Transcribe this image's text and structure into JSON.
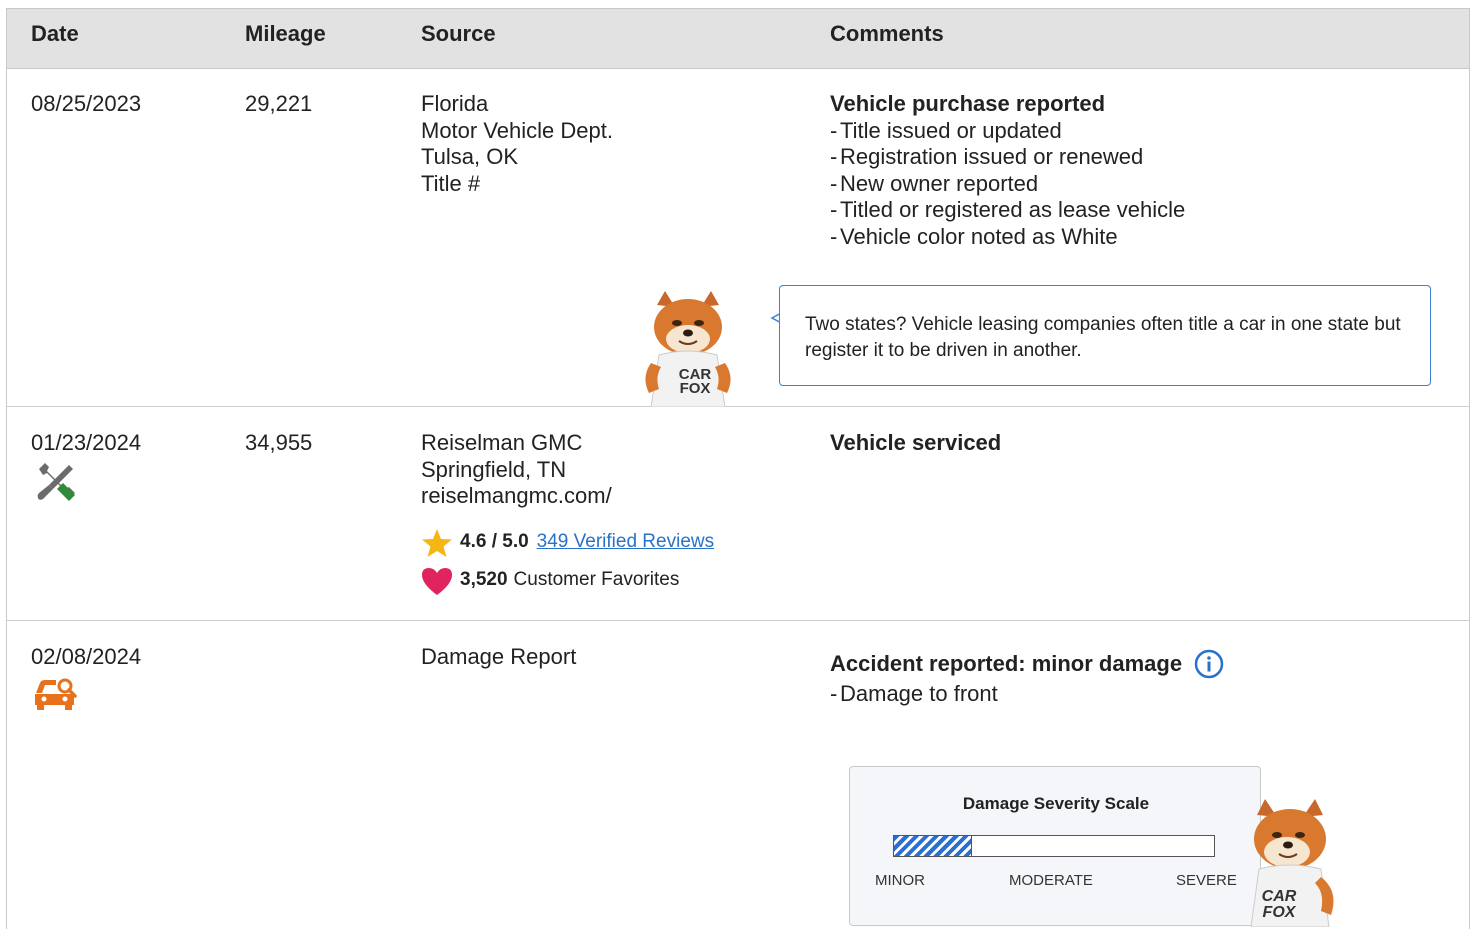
{
  "header": {
    "date": "Date",
    "mileage": "Mileage",
    "source": "Source",
    "comments": "Comments"
  },
  "rows": [
    {
      "date": "08/25/2023",
      "mileage": "29,221",
      "source": [
        "Florida",
        "Motor Vehicle Dept.",
        "Tulsa, OK",
        "Title #"
      ],
      "comment_title": "Vehicle purchase reported",
      "comment_items": [
        "Title issued or updated",
        "Registration issued or renewed",
        "New owner reported",
        "Titled or registered as lease vehicle",
        "Vehicle color noted as White"
      ],
      "tip": "Two states? Vehicle leasing companies often title a car in one state but register it to be driven in another.",
      "mascot_shirt": [
        "CAR",
        "FOX"
      ]
    },
    {
      "date": "01/23/2024",
      "mileage": "34,955",
      "icon": "service-tools-icon",
      "source": [
        "Reiselman GMC",
        "Springfield, TN",
        "reiselmangmc.com/"
      ],
      "rating": "4.6 / 5.0",
      "reviews_link": "349 Verified Reviews",
      "favorites_count": "3,520",
      "favorites_label": "Customer Favorites",
      "comment_title": "Vehicle serviced"
    },
    {
      "date": "02/08/2024",
      "mileage": "",
      "icon": "car-damage-icon",
      "source": [
        "Damage Report"
      ],
      "comment_title": "Accident reported: minor damage",
      "comment_items": [
        "Damage to front"
      ],
      "severity": {
        "title": "Damage Severity Scale",
        "labels": [
          "MINOR",
          "MODERATE",
          "SEVERE"
        ],
        "level_fraction": 0.24,
        "level_word": "MINOR"
      },
      "mascot_shirt": [
        "CAR",
        "FOX"
      ]
    }
  ],
  "colors": {
    "header_bg": "#e2e2e2",
    "link": "#2872c9",
    "star": "#f5b614",
    "heart": "#e0245e",
    "damage_icon": "#e8711c",
    "tool_green": "#2e8b3a",
    "bubble_border": "#3b82d6"
  }
}
